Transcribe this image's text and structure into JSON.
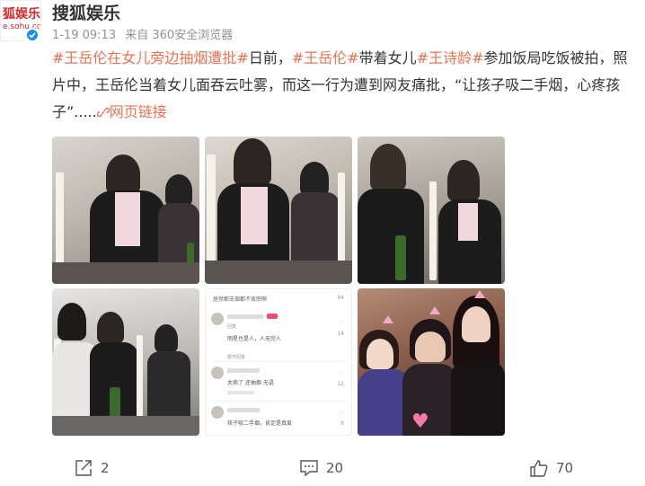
{
  "header": {
    "avatar_logo_main": "狐娱乐",
    "avatar_logo_sub": "e.sohu.com",
    "name": "搜狐娱乐",
    "time": "1-19 09:13",
    "source": "来自 360安全浏览器"
  },
  "post": {
    "tag1": "#王岳伦在女儿旁边抽烟遭批#",
    "t1": "日前，",
    "tag2": "#王岳伦#",
    "t2": "带着女儿",
    "tag3": "#王诗龄#",
    "t3": "参加饭局吃饭被拍，照片中，王岳伦当着女儿面吞云吐雾，而这一行为遭到网友痛批，“让孩子吸二手烟，心疼孩子”.....",
    "weblink": "网页链接"
  },
  "comments_screenshot": {
    "c1": "居然都支烟都不舍职啊",
    "c1_count": "64",
    "c2_reply": "回复",
    "c3": "明星也是人，人无完人",
    "c3_count": "14",
    "c3_sub": "展开回复",
    "c4": "太病了 还抽烟 无语",
    "c4_count": "12",
    "c5": "孩子吸二手烟，肯定是真爱",
    "c5_count": "6"
  },
  "footer": {
    "share_count": "2",
    "comment_count": "20",
    "like_count": "70"
  },
  "colors": {
    "accent": "#eb7350",
    "verified": "#1b8cf4"
  }
}
